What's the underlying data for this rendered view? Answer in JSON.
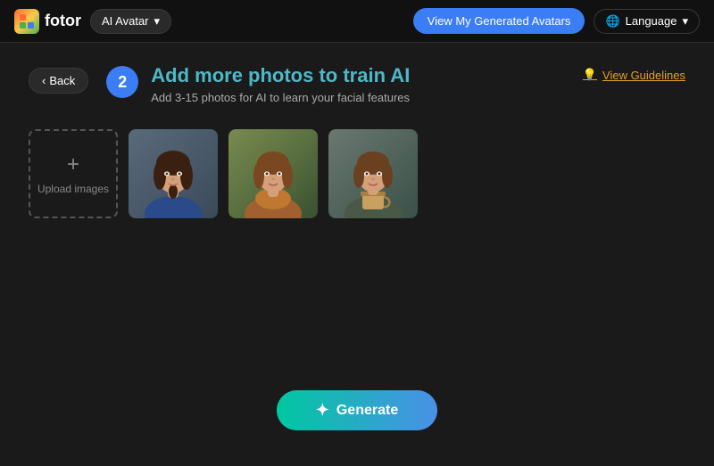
{
  "header": {
    "logo_text": "fotor",
    "ai_avatar_label": "AI Avatar",
    "dropdown_icon": "▾",
    "view_avatars_label": "View My Generated Avatars",
    "language_label": "Language",
    "language_icon": "🌐"
  },
  "nav": {
    "back_label": "Back",
    "chevron_left": "‹"
  },
  "step": {
    "number": "2",
    "title": "Add more photos to train AI",
    "subtitle": "Add 3-15 photos for AI to learn your facial features"
  },
  "guidelines": {
    "icon": "💡",
    "label": "View Guidelines"
  },
  "upload": {
    "plus_icon": "+",
    "label": "Upload images"
  },
  "generate": {
    "icon": "✦",
    "label": "Generate"
  },
  "photos": [
    {
      "id": "photo-1",
      "alt": "Woman with dark hair"
    },
    {
      "id": "photo-2",
      "alt": "Woman outdoors"
    },
    {
      "id": "photo-3",
      "alt": "Woman with coffee cup"
    }
  ]
}
